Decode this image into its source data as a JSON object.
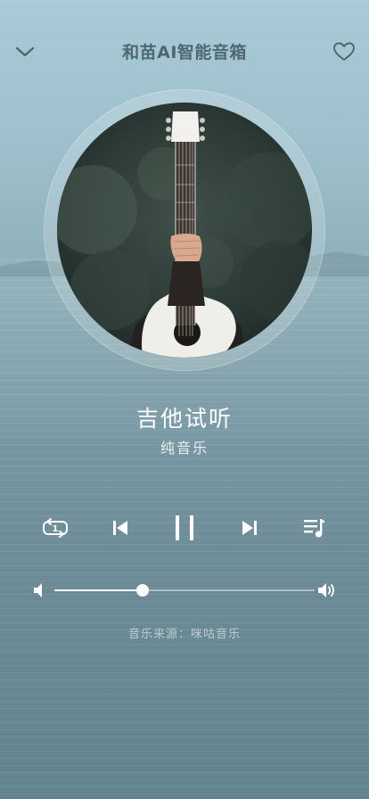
{
  "header": {
    "title": "和苗AI智能音箱",
    "back_icon": "chevron-down-icon",
    "favorite_icon": "heart-outline-icon"
  },
  "track": {
    "title": "吉他试听",
    "subtitle": "纯音乐"
  },
  "controls": {
    "repeat_icon": "repeat-one-icon",
    "repeat_badge": "1",
    "previous_icon": "skip-previous-icon",
    "play_pause_icon": "pause-icon",
    "next_icon": "skip-next-icon",
    "playlist_icon": "playlist-icon"
  },
  "volume": {
    "level": 0.34,
    "low_icon": "volume-low-icon",
    "high_icon": "volume-high-icon"
  },
  "source": {
    "text": "音乐来源：咪咕音乐"
  },
  "colors": {
    "title": "#4f6873",
    "control": "#ffffff",
    "background_top": "#a9cbd7",
    "background_bottom": "#668894"
  }
}
